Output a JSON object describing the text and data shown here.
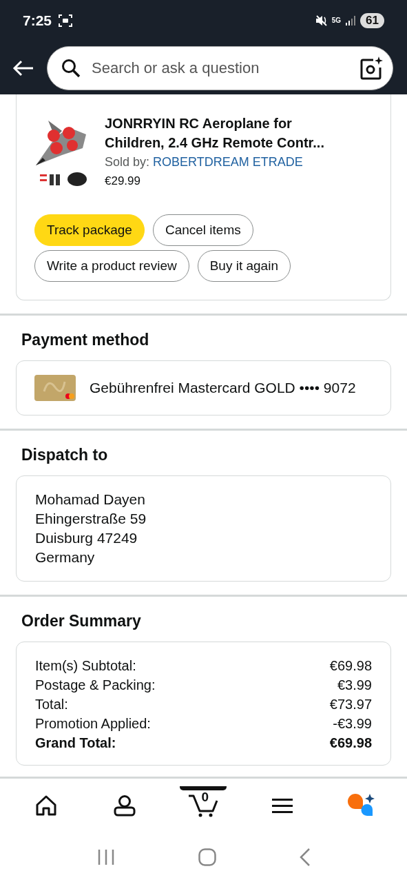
{
  "status_bar": {
    "time": "7:25",
    "battery": "61",
    "network": "5G"
  },
  "search": {
    "placeholder": "Search or ask a question"
  },
  "order_item": {
    "title": "JONRRYIN RC Aeroplane for Children, 2.4 GHz Remote Contr...",
    "sold_by_label": "Sold by:",
    "seller": "ROBERTDREAM ETRADE",
    "price": "€29.99",
    "actions": [
      {
        "label": "Track package",
        "kind": "primary"
      },
      {
        "label": "Cancel items",
        "kind": "secondary"
      },
      {
        "label": "Write a product review",
        "kind": "secondary"
      },
      {
        "label": "Buy it again",
        "kind": "secondary"
      }
    ]
  },
  "payment": {
    "heading": "Payment method",
    "card": "Gebührenfrei Mastercard GOLD •••• 9072"
  },
  "dispatch": {
    "heading": "Dispatch to",
    "address": [
      "Mohamad Dayen",
      "Ehingerstraße 59",
      "Duisburg 47249",
      "Germany"
    ]
  },
  "summary": {
    "heading": "Order Summary",
    "rows": [
      {
        "label": "Item(s) Subtotal:",
        "value": "€69.98",
        "bold": false
      },
      {
        "label": "Postage & Packing:",
        "value": "€3.99",
        "bold": false
      },
      {
        "label": "Total:",
        "value": "€73.97",
        "bold": false
      },
      {
        "label": "Promotion Applied:",
        "value": "-€3.99",
        "bold": false
      },
      {
        "label": "Grand Total:",
        "value": "€69.98",
        "bold": true
      }
    ]
  },
  "bottom_nav": [
    {
      "kind": "home",
      "selected": false
    },
    {
      "kind": "account",
      "selected": false
    },
    {
      "kind": "cart",
      "count": "0",
      "selected": true
    },
    {
      "kind": "menu",
      "selected": false
    },
    {
      "kind": "assistant",
      "selected": false
    }
  ]
}
